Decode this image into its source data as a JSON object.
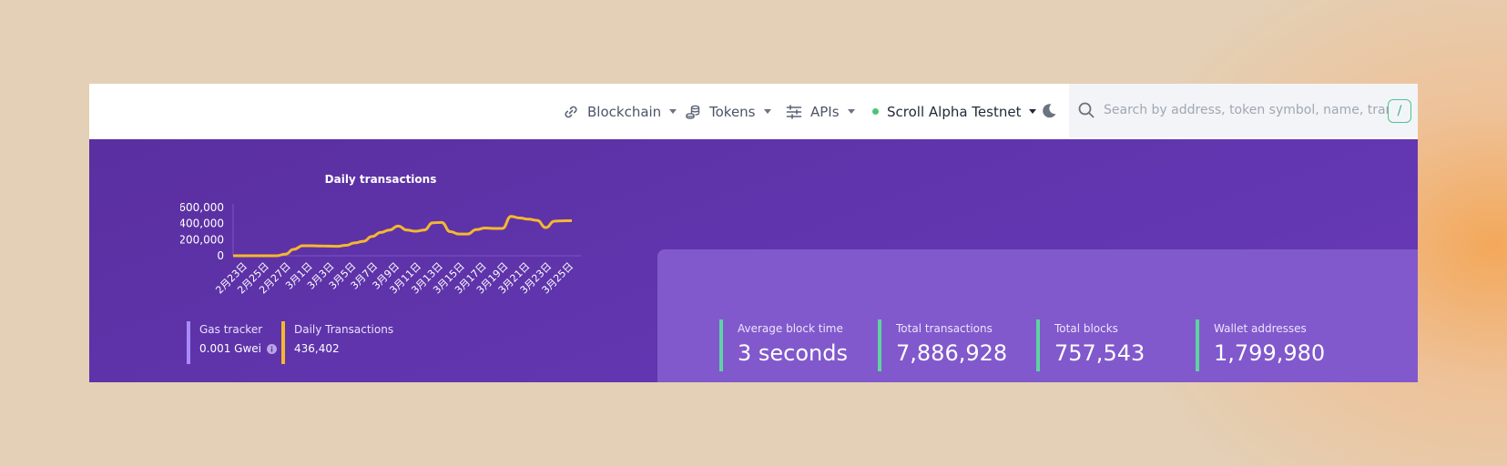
{
  "nav": {
    "items": [
      {
        "label": "Blockchain",
        "icon": "link-icon"
      },
      {
        "label": "Tokens",
        "icon": "coins-icon"
      },
      {
        "label": "APIs",
        "icon": "sliders-icon"
      }
    ],
    "network": {
      "label": "Scroll Alpha Testnet",
      "status_color": "#48c774"
    }
  },
  "search": {
    "placeholder": "Search by address, token symbol, name, transaction hash, or block number",
    "shortcut": "/"
  },
  "chart_data": {
    "type": "line",
    "title": "Daily transactions",
    "y_ticks": [
      "600,000",
      "400,000",
      "200,000",
      "0"
    ],
    "ylim": [
      0,
      600000
    ],
    "x_tick_labels": [
      "2月23日",
      "2月25日",
      "2月27日",
      "3月1日",
      "3月3日",
      "3月5日",
      "3月7日",
      "3月9日",
      "3月11日",
      "3月13日",
      "3月15日",
      "3月17日",
      "3月19日",
      "3月21日",
      "3月23日",
      "3月25日"
    ],
    "series_color": "#f5b82e",
    "values": [
      0,
      0,
      0,
      0,
      0,
      0,
      20000,
      80000,
      125000,
      125000,
      122000,
      120000,
      117000,
      130000,
      160000,
      180000,
      240000,
      290000,
      320000,
      370000,
      320000,
      305000,
      320000,
      410000,
      415000,
      300000,
      270000,
      270000,
      325000,
      345000,
      340000,
      340000,
      490000,
      470000,
      455000,
      440000,
      350000,
      430000,
      435000,
      436402
    ]
  },
  "mini_stats": [
    {
      "label": "Gas tracker",
      "value": "0.001 Gwei",
      "accent": "#a78bfa"
    },
    {
      "label": "Daily Transactions",
      "value": "436,402",
      "accent": "#f5b82e"
    }
  ],
  "stats": [
    {
      "label": "Average block time",
      "value": "3 seconds"
    },
    {
      "label": "Total transactions",
      "value": "7,886,928"
    },
    {
      "label": "Total blocks",
      "value": "757,543"
    },
    {
      "label": "Wallet addresses",
      "value": "1,799,980"
    }
  ]
}
